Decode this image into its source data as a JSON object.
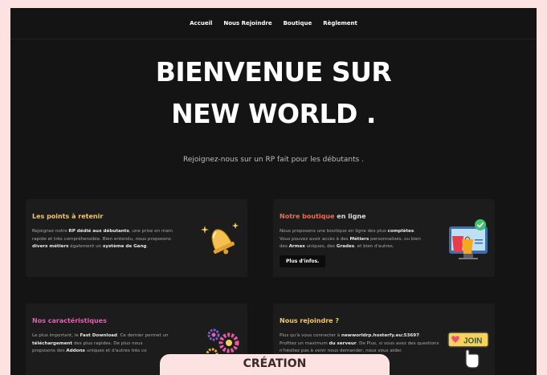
{
  "nav": {
    "items": [
      "Accueil",
      "Nous Rejoindre",
      "Boutique",
      "Règlement"
    ]
  },
  "hero": {
    "line1": "BIENVENUE SUR",
    "line2": "NEW WORLD .",
    "subtitle": "Rejoignez-nous sur un RP fait pour les débutants ."
  },
  "cards": {
    "points": {
      "title": "Les points à retenir",
      "title_color": "#f2c76a",
      "lines": [
        [
          "Rejoignez notre ",
          {
            "b": "RP dédié aux débutants"
          },
          ", une prise en main"
        ],
        [
          "rapide et très compréhensible. Bien entendu, nous proposons"
        ],
        [
          {
            "b": "divers métiers"
          },
          " également un ",
          {
            "b": "système de Gang"
          },
          "."
        ]
      ],
      "icon": "bell-icon"
    },
    "shop": {
      "title_a": "Notre boutique",
      "title_b": " en ligne",
      "title_color_a": "#ee6b4d",
      "lines": [
        [
          "Nous proposons une boutique en ligne des plus ",
          {
            "b": "complètes"
          },
          "."
        ],
        [
          "Vous pouvez avoir accès à des ",
          {
            "b": "Métiers"
          },
          " personnalisés, ou bien"
        ],
        [
          "des ",
          {
            "b": "Armes"
          },
          " uniques, des ",
          {
            "b": "Grades"
          },
          ", et bien d'autres."
        ]
      ],
      "button": "Plus d'infos.",
      "icon": "shopping-bag-icon"
    },
    "features": {
      "title": "Nos caractéristiques",
      "title_color": "#e45fb0",
      "lines": [
        [
          "Le plus important, le ",
          {
            "b": "Fast Download"
          },
          ". Ce dernier permet un"
        ],
        [
          {
            "b": "téléchargement"
          },
          " des plus rapides. De plus nous"
        ],
        [
          "proposons des ",
          {
            "b": "Addons"
          },
          " uniques et d'autres très co"
        ]
      ],
      "icon": "gears-icon"
    },
    "join": {
      "title": "Nous rejoindre ?",
      "title_color": "#f2c76a",
      "lines": [
        [
          "Plus qu'à vous connecter à ",
          {
            "b": "newworldrp.hosterfy.eu:53697"
          },
          "."
        ],
        [
          "Profitez un maximum ",
          {
            "b": "du serveur"
          },
          ". De Plus, si vous avez des questions"
        ],
        [
          "n'hésitez pas à venir nous demander, nous vous aider."
        ]
      ],
      "badge": "JOIN",
      "icon": "join-badge-icon"
    }
  },
  "footer_tab": "CRÉATION"
}
